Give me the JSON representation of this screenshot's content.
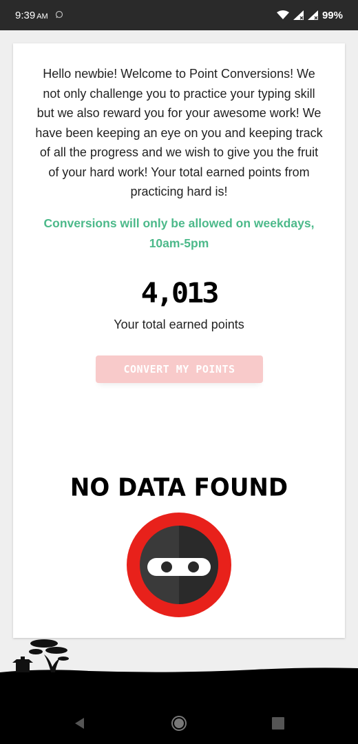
{
  "status_bar": {
    "time": "9:39",
    "ampm": "AM",
    "battery": "99%"
  },
  "intro_text": "Hello newbie! Welcome to Point Conversions! We not only challenge you to practice your typing skill but we also reward you for your awesome work! We have been keeping an eye on you and keeping track of all the progress and we wish to give you the fruit of your hard work! Your total earned points from practicing hard is!",
  "notice_text": "Conversions will only be allowed on weekdays, 10am-5pm",
  "total_points": "4,013",
  "points_label": "Your total earned points",
  "convert_button_label": "Convert my points",
  "no_data_text": "No data found",
  "colors": {
    "notice_green": "#4cb98a",
    "button_pink": "#f8caca",
    "ninja_red": "#e8211b"
  },
  "icons": {
    "nav": [
      "back-icon",
      "home-icon",
      "recents-icon"
    ],
    "status": [
      "wifi-icon",
      "signal-icon",
      "signal-icon",
      "whatsapp-icon"
    ]
  }
}
